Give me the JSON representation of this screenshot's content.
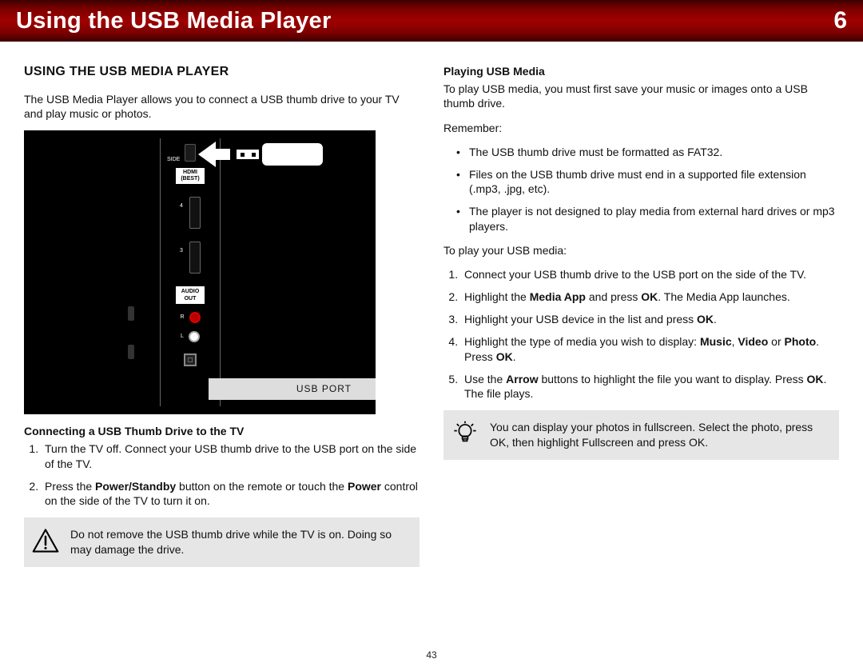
{
  "header": {
    "title": "Using the USB Media Player",
    "chapter_number": "6"
  },
  "left": {
    "heading": "USING THE USB MEDIA PLAYER",
    "intro": "The USB Media Player allows you to connect a USB thumb drive to your TV and play music or photos.",
    "figure": {
      "side_label": "SIDE",
      "hdmi_label": "HDMI (BEST)",
      "port4": "4",
      "port3": "3",
      "audio_label": "AUDIO OUT",
      "r": "R",
      "l": "L",
      "caption": "USB PORT"
    },
    "subhead": "Connecting a USB Thumb Drive to the TV",
    "steps": {
      "s1": "Turn the TV off. Connect your USB thumb drive to the USB port on the side of the TV.",
      "s2_a": "Press the ",
      "s2_b": "Power/Standby",
      "s2_c": " button on the remote or touch the ",
      "s2_d": "Power",
      "s2_e": " control on the side of the TV to turn it on."
    },
    "warning": "Do not remove the USB thumb drive while the TV is on. Doing so may damage the drive."
  },
  "right": {
    "subhead": "Playing USB Media",
    "intro": "To play USB media, you must first save your music or images onto a USB thumb drive.",
    "remember_label": "Remember:",
    "remember": {
      "r1": "The USB thumb drive must be formatted as FAT32.",
      "r2": "Files on the USB thumb drive must end in a supported file extension (.mp3, .jpg, etc).",
      "r3": "The player is not designed to play media from external hard drives or mp3 players."
    },
    "play_label": "To play your USB media:",
    "steps": {
      "p1": "Connect your USB thumb drive to the USB port on the side of the TV.",
      "p2_a": "Highlight the ",
      "p2_b": "Media App",
      "p2_c": " and press ",
      "p2_d": "OK",
      "p2_e": ". The Media App launches.",
      "p3_a": "Highlight your USB device in the list and press ",
      "p3_b": "OK",
      "p3_c": ".",
      "p4_a": "Highlight the type of media you wish to display: ",
      "p4_b": "Music",
      "p4_c": ", ",
      "p4_d": "Video",
      "p4_e": " or ",
      "p4_f": "Photo",
      "p4_g": ". Press ",
      "p4_h": "OK",
      "p4_i": ".",
      "p5_a": "Use the ",
      "p5_b": "Arrow",
      "p5_c": " buttons to highlight the file you want to display. Press ",
      "p5_d": "OK",
      "p5_e": ". The file plays."
    },
    "tip": "You can display your photos in fullscreen. Select the photo, press OK, then highlight Fullscreen and press OK."
  },
  "page_number": "43"
}
